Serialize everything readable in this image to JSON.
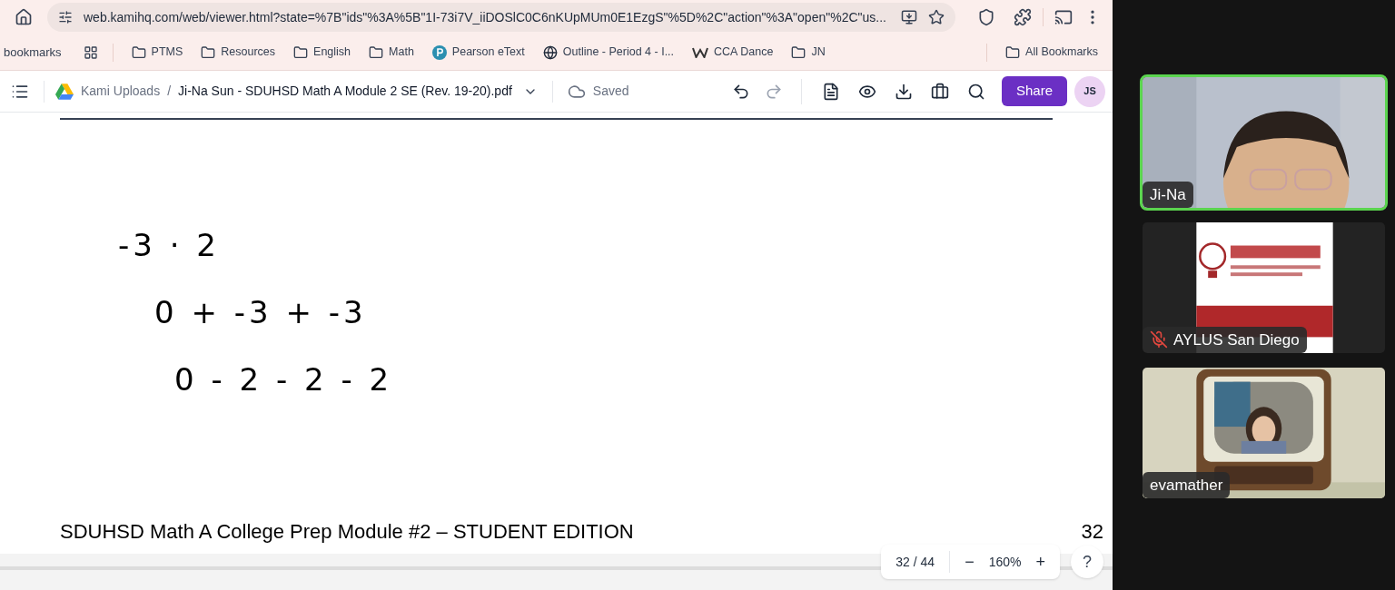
{
  "browser": {
    "url": "web.kamihq.com/web/viewer.html?state=%7B\"ids\"%3A%5B\"1I-73i7V_iiDOSlC0C6nKUpMUm0E1EzgS\"%5D%2C\"action\"%3A\"open\"%2C\"us...",
    "bookmarks": [
      {
        "kind": "text",
        "label": "bookmarks"
      },
      {
        "kind": "apps"
      },
      {
        "kind": "folder",
        "label": "PTMS"
      },
      {
        "kind": "folder",
        "label": "Resources"
      },
      {
        "kind": "folder",
        "label": "English"
      },
      {
        "kind": "folder",
        "label": "Math"
      },
      {
        "kind": "pearson",
        "label": "Pearson eText"
      },
      {
        "kind": "globe",
        "label": "Outline - Period 4 - I..."
      },
      {
        "kind": "w",
        "label": "CCA Dance"
      },
      {
        "kind": "folder",
        "label": "JN"
      }
    ],
    "all_bookmarks": "All Bookmarks"
  },
  "kami": {
    "folder": "Kami Uploads",
    "separator": "/",
    "file": "Ji-Na Sun - SDUHSD Math A Module 2 SE (Rev. 19-20).pdf",
    "status": "Saved",
    "share": "Share",
    "avatar": "JS"
  },
  "page": {
    "ink_lines": [
      "-3 · 2",
      "0 + -3 + -3",
      "0 - 2 - 2 - 2"
    ],
    "footer": "SDUHSD Math A College Prep Module #2 – STUDENT EDITION",
    "page_number": "32"
  },
  "zoom_bar": {
    "pages": "32 / 44",
    "minus": "−",
    "zoom": "160%",
    "plus": "+",
    "help": "?"
  },
  "participants": [
    {
      "name": "Ji-Na",
      "selected": true,
      "muted": false,
      "kind": "face"
    },
    {
      "name": "AYLUS San Diego",
      "selected": false,
      "muted": true,
      "kind": "logo"
    },
    {
      "name": "evamather",
      "selected": false,
      "muted": false,
      "kind": "tv"
    }
  ]
}
